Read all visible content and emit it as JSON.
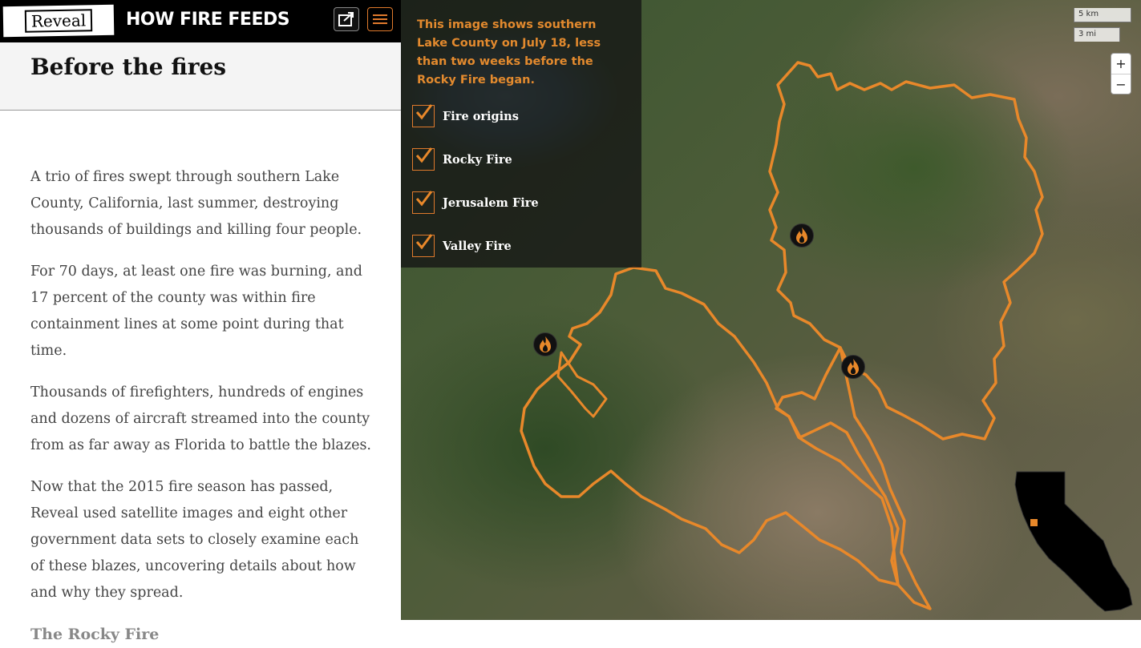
{
  "header": {
    "logo_text": "Reveal",
    "site_title": "HOW FIRE FEEDS",
    "share_icon": "share-icon",
    "menu_icon": "hamburger-menu-icon"
  },
  "section": {
    "title": "Before the fires"
  },
  "story": {
    "paragraphs": [
      "A trio of fires swept through southern Lake County, California, last summer, destroying thousands of buildings and killing four people.",
      "For 70 days, at least one fire was burning, and 17 percent of the county was within fire containment lines at some point during that time.",
      "Thousands of firefighters, hundreds of engines and dozens of aircraft streamed into the county from as far away as Florida to battle the blazes.",
      "Now that the 2015 fire season has passed, Reveal used satellite images and eight other government data sets to closely examine each of these blazes, uncovering details about how and why they spread."
    ],
    "next_heading": "The Rocky Fire"
  },
  "map": {
    "caption": "This image shows southern Lake County on July 18, less than two weeks before the Rocky Fire began.",
    "layers": [
      {
        "label": "Fire origins",
        "checked": true
      },
      {
        "label": "Rocky Fire",
        "checked": true
      },
      {
        "label": "Jerusalem Fire",
        "checked": true
      },
      {
        "label": "Valley Fire",
        "checked": true
      }
    ],
    "scale": {
      "km": "5 km",
      "mi": "3 mi"
    },
    "zoom_in": "+",
    "zoom_out": "−",
    "accent_color": "#e8882a",
    "marker_icon": "fire-icon"
  }
}
